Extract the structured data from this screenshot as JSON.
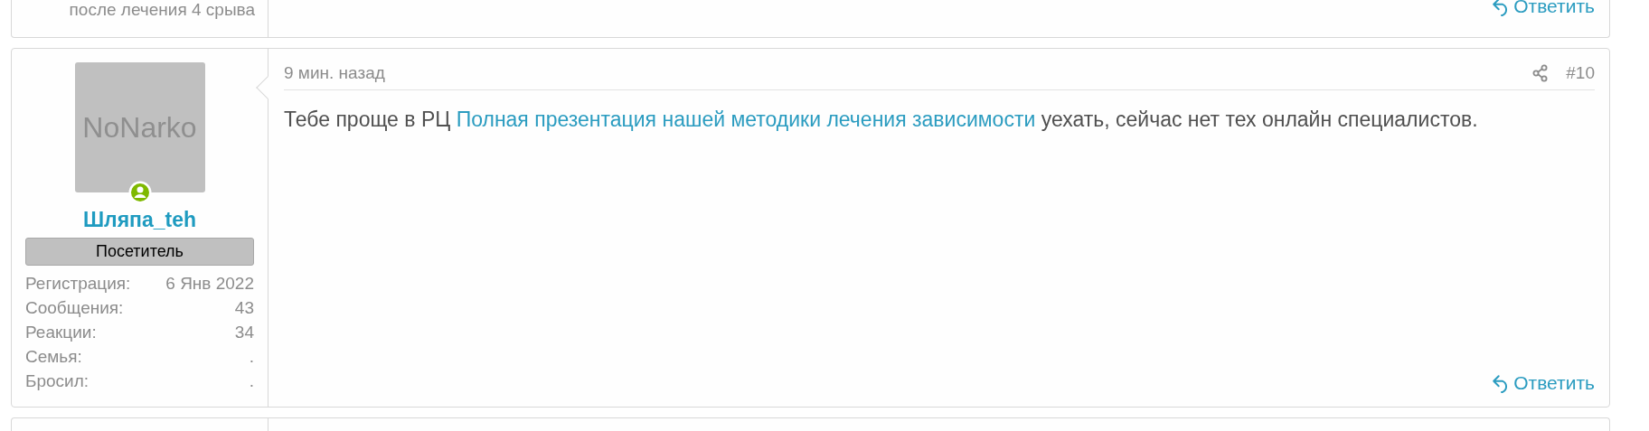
{
  "previous_post": {
    "user_extra": "после лечения 4 срыва",
    "reply": "Ответить"
  },
  "post": {
    "avatar_text": "NoNarko",
    "online": true,
    "username": "Шляпа_teh",
    "user_title": "Посетитель",
    "stats": [
      {
        "label": "Регистрация:",
        "value": "6 Янв 2022"
      },
      {
        "label": "Сообщения:",
        "value": "43"
      },
      {
        "label": "Реакции:",
        "value": "34"
      },
      {
        "label": "Семья:",
        "value": "."
      },
      {
        "label": "Бросил:",
        "value": "."
      }
    ],
    "time": "9 мин. назад",
    "number": "#10",
    "body": [
      {
        "kind": "text",
        "text": "Тебе проще в РЦ "
      },
      {
        "kind": "link",
        "text": "Полная презентация нашей методики лечения зависимости"
      },
      {
        "kind": "text",
        "text": " уехать, сейчас нет тех онлайн специалистов."
      }
    ],
    "reply": "Ответить"
  }
}
